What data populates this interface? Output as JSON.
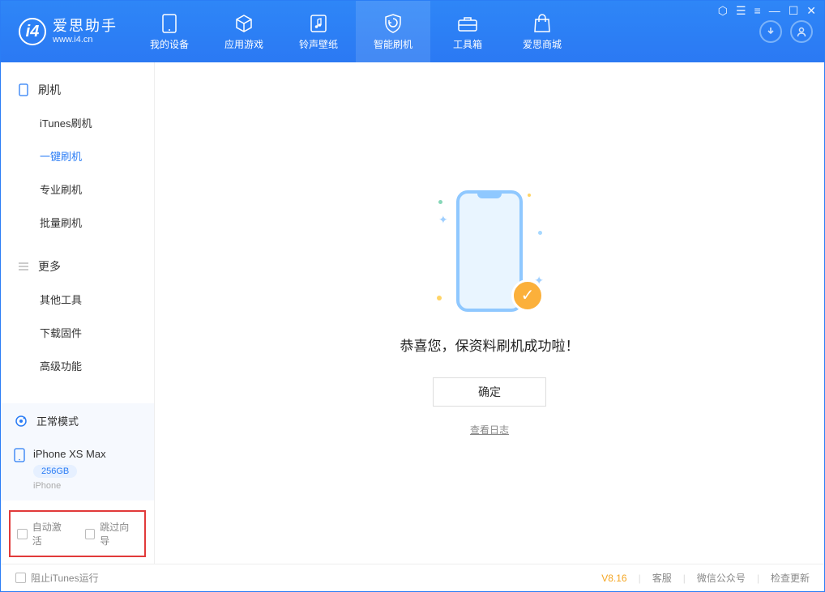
{
  "app": {
    "name": "爱思助手",
    "url": "www.i4.cn"
  },
  "header_tabs": [
    {
      "label": "我的设备"
    },
    {
      "label": "应用游戏"
    },
    {
      "label": "铃声壁纸"
    },
    {
      "label": "智能刷机"
    },
    {
      "label": "工具箱"
    },
    {
      "label": "爱思商城"
    }
  ],
  "sidebar": {
    "section1": {
      "title": "刷机",
      "items": [
        "iTunes刷机",
        "一键刷机",
        "专业刷机",
        "批量刷机"
      ]
    },
    "section2": {
      "title": "更多",
      "items": [
        "其他工具",
        "下载固件",
        "高级功能"
      ]
    }
  },
  "device_mode": "正常模式",
  "device": {
    "name": "iPhone XS Max",
    "storage": "256GB",
    "type": "iPhone"
  },
  "checkboxes": {
    "auto_activate": "自动激活",
    "skip_guide": "跳过向导"
  },
  "main": {
    "success_msg": "恭喜您，保资料刷机成功啦！",
    "ok": "确定",
    "view_log": "查看日志"
  },
  "footer": {
    "block_itunes": "阻止iTunes运行",
    "version": "V8.16",
    "links": [
      "客服",
      "微信公众号",
      "检查更新"
    ]
  }
}
